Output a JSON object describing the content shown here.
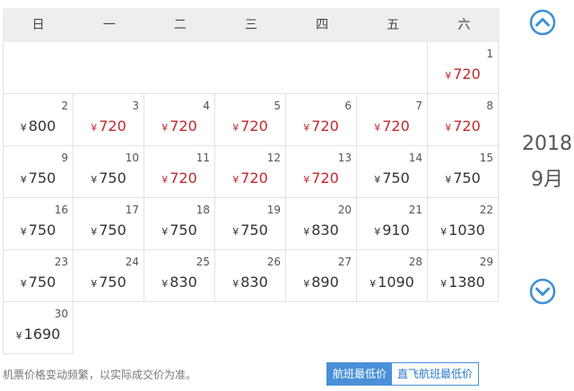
{
  "weekdays": [
    "日",
    "一",
    "二",
    "三",
    "四",
    "五",
    "六"
  ],
  "year": "2018",
  "month": "9月",
  "currency": "¥",
  "days": [
    {
      "day": "1",
      "price": "720",
      "low": true
    },
    {
      "day": "2",
      "price": "800",
      "low": false
    },
    {
      "day": "3",
      "price": "720",
      "low": true
    },
    {
      "day": "4",
      "price": "720",
      "low": true
    },
    {
      "day": "5",
      "price": "720",
      "low": true
    },
    {
      "day": "6",
      "price": "720",
      "low": true
    },
    {
      "day": "7",
      "price": "720",
      "low": true
    },
    {
      "day": "8",
      "price": "720",
      "low": true
    },
    {
      "day": "9",
      "price": "750",
      "low": false
    },
    {
      "day": "10",
      "price": "750",
      "low": false
    },
    {
      "day": "11",
      "price": "720",
      "low": true
    },
    {
      "day": "12",
      "price": "720",
      "low": true
    },
    {
      "day": "13",
      "price": "720",
      "low": true
    },
    {
      "day": "14",
      "price": "750",
      "low": false
    },
    {
      "day": "15",
      "price": "750",
      "low": false
    },
    {
      "day": "16",
      "price": "750",
      "low": false
    },
    {
      "day": "17",
      "price": "750",
      "low": false
    },
    {
      "day": "18",
      "price": "750",
      "low": false
    },
    {
      "day": "19",
      "price": "750",
      "low": false
    },
    {
      "day": "20",
      "price": "830",
      "low": false
    },
    {
      "day": "21",
      "price": "910",
      "low": false
    },
    {
      "day": "22",
      "price": "1030",
      "low": false
    },
    {
      "day": "23",
      "price": "750",
      "low": false
    },
    {
      "day": "24",
      "price": "750",
      "low": false
    },
    {
      "day": "25",
      "price": "830",
      "low": false
    },
    {
      "day": "26",
      "price": "830",
      "low": false
    },
    {
      "day": "27",
      "price": "890",
      "low": false
    },
    {
      "day": "28",
      "price": "1090",
      "low": false
    },
    {
      "day": "29",
      "price": "1380",
      "low": false
    },
    {
      "day": "30",
      "price": "1690",
      "low": false
    }
  ],
  "first_weekday": 6,
  "note": "机票价格变动频繁，以实际成交价为准。",
  "tabs": [
    {
      "label": "航班最低价",
      "active": true
    },
    {
      "label": "直飞航班最低价",
      "active": false
    }
  ],
  "colors": {
    "low_price": "#c4282c",
    "normal_price": "#333333",
    "accent": "#4a90d9"
  },
  "icons": {
    "prev": "chevron-up-circle-icon",
    "next": "chevron-down-circle-icon"
  }
}
